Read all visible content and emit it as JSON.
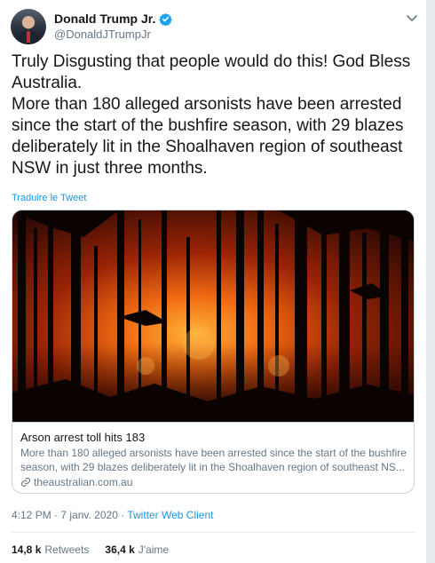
{
  "user": {
    "display_name": "Donald Trump Jr.",
    "handle": "@DonaldJTrumpJr",
    "verified": true
  },
  "tweet": {
    "line1": "Truly Disgusting that people would do this! God Bless Australia.",
    "line2": "More than 180 alleged arsonists have been arrested since the start of the bushfire season, with 29 blazes deliberately lit in the Shoalhaven region of southeast NSW in just three months.",
    "translate_label": "Traduire le Tweet"
  },
  "link_card": {
    "title": "Arson arrest toll hits 183",
    "description": "More than 180 alleged arsonists have been arrested since the start of the bushfire season, with 29 blazes deliberately lit in the Shoalhaven region of southeast NS...",
    "domain": "theaustralian.com.au",
    "image_alt": "Bushfire burning behind silhouetted trees"
  },
  "meta": {
    "time": "4:12 PM",
    "separator": " · ",
    "date": "7 janv. 2020",
    "source": "Twitter Web Client"
  },
  "stats": {
    "retweets_count": "14,8 k",
    "retweets_label": "Retweets",
    "likes_count": "36,4 k",
    "likes_label": "J'aime"
  },
  "colors": {
    "accent": "#1b95e0",
    "secondary_text": "#657786",
    "verified": "#1da1f2"
  }
}
